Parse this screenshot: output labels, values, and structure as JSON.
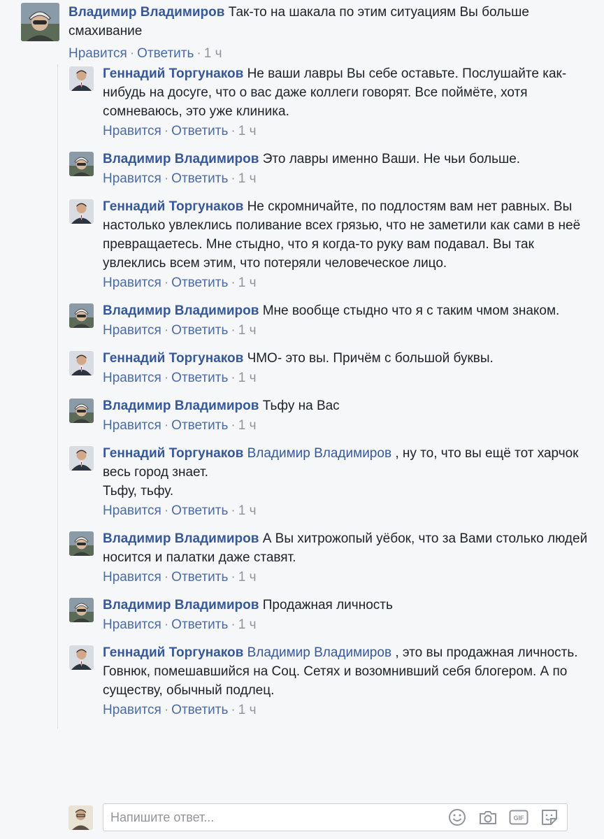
{
  "top_comment": {
    "author": "Владимир Владимиров",
    "text": "Так-то на шакала по этим ситуациям Вы больше смахивание",
    "like": "Нравится",
    "reply": "Ответить",
    "time": "1 ч"
  },
  "replies": [
    {
      "author": "Геннадий Торгунаков",
      "avatar": "man-suit",
      "mention": "",
      "text": "Не ваши лавры Вы себе оставьте. Послушайте как-нибудь на досуге, что о вас даже коллеги говорят. Все поймёте, хотя сомневаюсь, это уже клиника.",
      "like": "Нравится",
      "reply": "Ответить",
      "time": "1 ч"
    },
    {
      "author": "Владимир Владимиров",
      "avatar": "cyclist",
      "mention": "",
      "text": "Это лавры именно Ваши. Не чьи больше.",
      "like": "Нравится",
      "reply": "Ответить",
      "time": "1 ч"
    },
    {
      "author": "Геннадий Торгунаков",
      "avatar": "man-suit",
      "mention": "",
      "text": "Не скромничайте, по подлостям вам нет равных. Вы настолько увлеклись поливание всех грязью, что не заметили как сами в неё превращаетесь. Мне стыдно, что я когда-то руку вам подавал. Вы так увлеклись всем этим, что потеряли человеческое лицо.",
      "like": "Нравится",
      "reply": "Ответить",
      "time": "1 ч"
    },
    {
      "author": "Владимир Владимиров",
      "avatar": "cyclist",
      "mention": "",
      "text": "Мне вообще стыдно что я с таким чмом знаком.",
      "like": "Нравится",
      "reply": "Ответить",
      "time": "1 ч"
    },
    {
      "author": "Геннадий Торгунаков",
      "avatar": "man-suit",
      "mention": "",
      "text": "ЧМО- это вы. Причём с большой буквы.",
      "like": "Нравится",
      "reply": "Ответить",
      "time": "1 ч"
    },
    {
      "author": "Владимир Владимиров",
      "avatar": "cyclist",
      "mention": "",
      "text": "Тьфу на Вас",
      "like": "Нравится",
      "reply": "Ответить",
      "time": "1 ч"
    },
    {
      "author": "Геннадий Торгунаков",
      "avatar": "man-suit",
      "mention": "Владимир Владимиров",
      "text": " , ну то, что вы ещё тот харчок весь город знает.\nТьфу, тьфу.",
      "like": "Нравится",
      "reply": "Ответить",
      "time": "1 ч"
    },
    {
      "author": "Владимир Владимиров",
      "avatar": "cyclist",
      "mention": "",
      "text": "А Вы хитрожопый уёбок, что за Вами столько людей носится и палатки даже ставят.",
      "like": "Нравится",
      "reply": "Ответить",
      "time": "1 ч"
    },
    {
      "author": "Владимир Владимиров",
      "avatar": "cyclist",
      "mention": "",
      "text": "Продажная личность",
      "like": "Нравится",
      "reply": "Ответить",
      "time": "1 ч"
    },
    {
      "author": "Геннадий Торгунаков",
      "avatar": "man-suit",
      "mention": "Владимир Владимиров",
      "text": " , это вы продажная личность. Говнюк, помешавшийся на Соц. Сетях и возомнивший себя блогером. А по существу, обычный подлец.",
      "like": "Нравится",
      "reply": "Ответить",
      "time": "1 ч"
    }
  ],
  "composer": {
    "placeholder": "Напишите ответ...",
    "tools": [
      "emoji-icon",
      "camera-icon",
      "gif-icon",
      "sticker-icon"
    ]
  },
  "colors": {
    "author": "#365899",
    "meta": "#90949c",
    "background": "#f6f7f9"
  }
}
